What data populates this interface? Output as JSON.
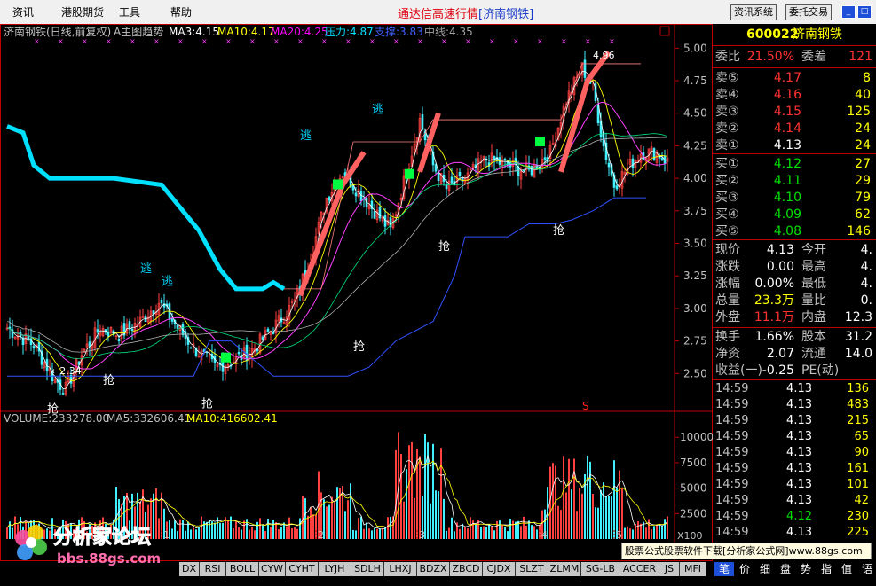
{
  "menu": [
    "资讯",
    "港股期货",
    "工具",
    "帮助"
  ],
  "app_title": "通达信高速行情",
  "app_subtitle": "[济南钢铁]",
  "toolbar": {
    "news_label": "资讯系统",
    "trade_label": "委托交易"
  },
  "chart_data": {
    "type": "candlestick",
    "header": {
      "name": "济南钢铁(日线,前复权)",
      "formula": "A主图趋势",
      "ma3_label": "MA3:4.15",
      "ma10_label": "MA10:4.17",
      "ma20_label": "MA20:4.25",
      "pressure_label": "压力:4.87",
      "support_label": "支撑:3.83",
      "mid_label": "中线:4.35"
    },
    "price_axis": {
      "ticks": [
        "5.00",
        "4.75",
        "4.50",
        "4.25",
        "4.00",
        "3.75",
        "3.50",
        "3.25",
        "3.00",
        "2.75",
        "2.50"
      ],
      "ylim": [
        2.25,
        5.05
      ]
    },
    "annotations": [
      {
        "text": "逃",
        "color": "#00d8ff"
      },
      {
        "text": "抢",
        "color": "#ffffff"
      }
    ],
    "low_label": "←2.34",
    "high_label": "4.96",
    "volume": {
      "header": "VOLUME:233278.00",
      "ma5": "MA5:332606.41",
      "ma10": "MA10:416602.41",
      "ticks": [
        "10000",
        "7500",
        "5000",
        "2500"
      ],
      "unit": "X100"
    },
    "month_labels": [
      "1",
      "2",
      "3",
      "4",
      "5"
    ],
    "s_marker": "S"
  },
  "quote": {
    "code": "600022",
    "name": "济南钢铁",
    "weibi_label": "委比",
    "weibi": "21.50%",
    "weicha_label": "委差",
    "weicha": "121",
    "asks": [
      {
        "label": "卖⑤",
        "price": "4.17",
        "vol": "8",
        "color": "#ff3232"
      },
      {
        "label": "卖④",
        "price": "4.16",
        "vol": "40",
        "color": "#ff3232"
      },
      {
        "label": "卖③",
        "price": "4.15",
        "vol": "125",
        "color": "#ff3232"
      },
      {
        "label": "卖②",
        "price": "4.14",
        "vol": "24",
        "color": "#ff3232"
      },
      {
        "label": "卖①",
        "price": "4.13",
        "vol": "24",
        "color": "#ffffff"
      }
    ],
    "bids": [
      {
        "label": "买①",
        "price": "4.12",
        "vol": "27",
        "color": "#00e000"
      },
      {
        "label": "买②",
        "price": "4.11",
        "vol": "29",
        "color": "#00e000"
      },
      {
        "label": "买③",
        "price": "4.10",
        "vol": "79",
        "color": "#00e000"
      },
      {
        "label": "买④",
        "price": "4.09",
        "vol": "62",
        "color": "#00e000"
      },
      {
        "label": "买⑤",
        "price": "4.08",
        "vol": "146",
        "color": "#00e000"
      }
    ],
    "stats": [
      {
        "l1": "现价",
        "v1": "4.13",
        "c1": "#ffffff",
        "l2": "今开",
        "v2": "4."
      },
      {
        "l1": "涨跌",
        "v1": "0.00",
        "c1": "#ffffff",
        "l2": "最高",
        "v2": "4."
      },
      {
        "l1": "涨幅",
        "v1": "0.00%",
        "c1": "#ffffff",
        "l2": "最低",
        "v2": "4."
      },
      {
        "l1": "总量",
        "v1": "23.3万",
        "c1": "#ffff00",
        "l2": "量比",
        "v2": "0."
      },
      {
        "l1": "外盘",
        "v1": "11.1万",
        "c1": "#ff3232",
        "l2": "内盘",
        "v2": "12.3"
      }
    ],
    "fund": [
      {
        "l1": "换手",
        "v1": "1.66%",
        "l2": "股本",
        "v2": "31.2"
      },
      {
        "l1": "净资",
        "v1": "2.07",
        "l2": "流通",
        "v2": "14.0"
      },
      {
        "l1": "收益(一)",
        "v1": "-0.25",
        "l2": "PE(动)",
        "v2": ""
      }
    ],
    "ticks": [
      {
        "time": "14:59",
        "price": "4.13",
        "vol": "136"
      },
      {
        "time": "14:59",
        "price": "4.13",
        "vol": "483"
      },
      {
        "time": "14:59",
        "price": "4.13",
        "vol": "215"
      },
      {
        "time": "14:59",
        "price": "4.13",
        "vol": "65"
      },
      {
        "time": "14:59",
        "price": "4.13",
        "vol": "90"
      },
      {
        "time": "14:59",
        "price": "4.13",
        "vol": "161"
      },
      {
        "time": "14:59",
        "price": "4.13",
        "vol": "101"
      },
      {
        "time": "14:59",
        "price": "4.13",
        "vol": "42"
      },
      {
        "time": "14:59",
        "price": "4.12",
        "vol": "230",
        "pcolor": "#00e000"
      },
      {
        "time": "14:59",
        "price": "4.13",
        "vol": "225"
      }
    ]
  },
  "indicator_tabs": [
    "DX",
    "RSI",
    "BOLL",
    "CYW",
    "CYHT",
    "LYJH",
    "SDLH",
    "LHXJ",
    "BDZX",
    "ZBCD",
    "CJDX",
    "SLZT",
    "ZLMM",
    "SG-LB",
    "ACCER",
    "JS",
    "MFI"
  ],
  "right_tabs": [
    "笔",
    "价",
    "细",
    "盘",
    "势",
    "指",
    "值",
    "语"
  ],
  "ad_text": "股票公式股票软件下载[分析家公式网]www.88gs.com",
  "watermark": {
    "title": "分析家论坛",
    "url": "bbs.88gs.com"
  }
}
